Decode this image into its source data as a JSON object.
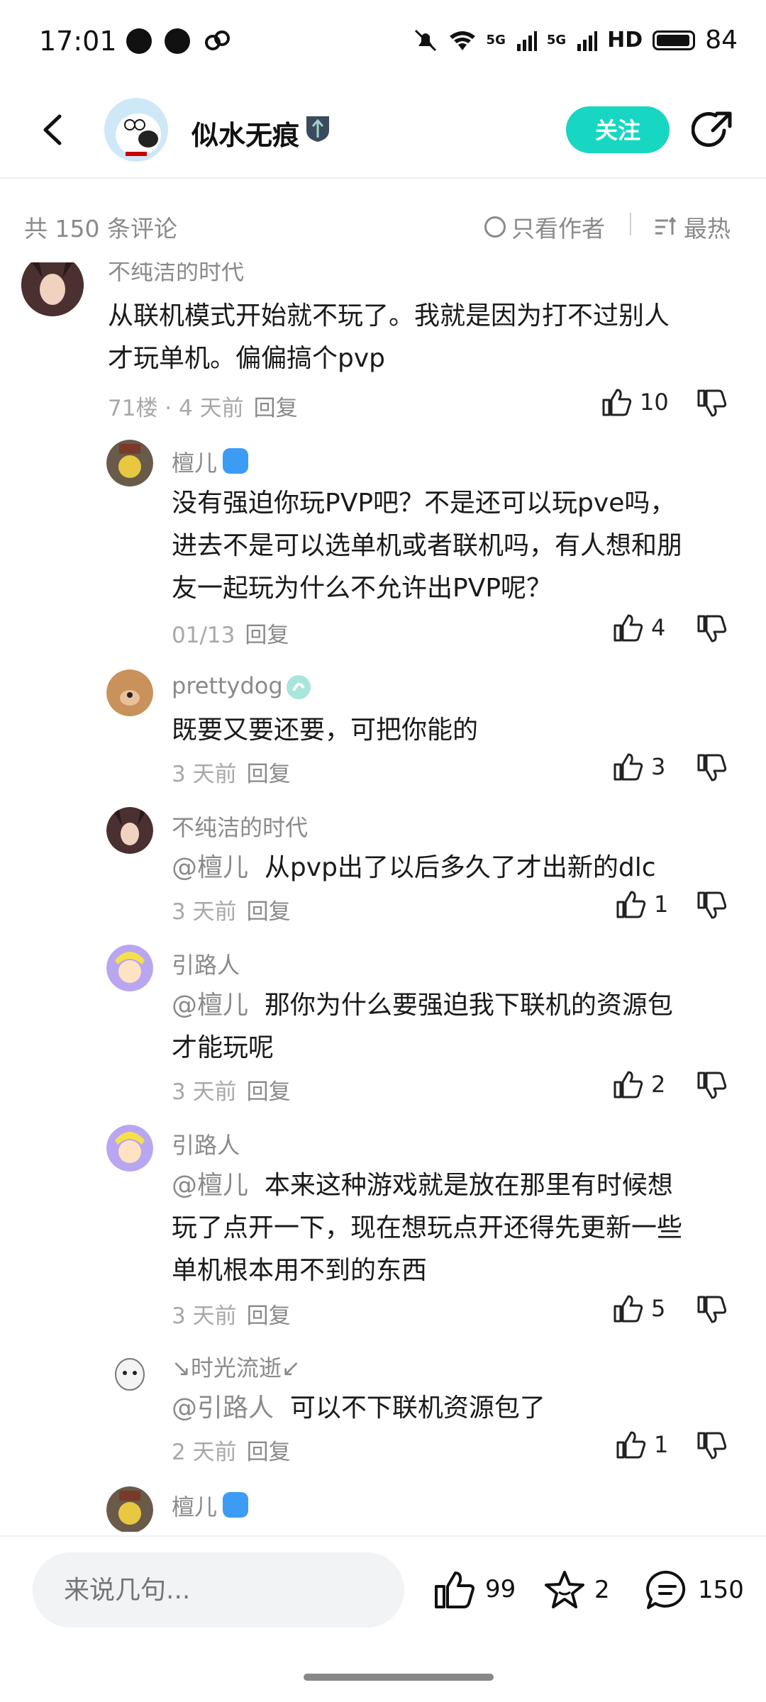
{
  "status_bar": {
    "time": "17:01",
    "network": "5G",
    "network2": "5G",
    "hd": "HD",
    "battery": "84"
  },
  "header": {
    "author_name": "似水无痕",
    "follow_label": "关注"
  },
  "filter": {
    "count_label": "共 150 条评论",
    "only_author_label": "只看作者",
    "sort_label": "最热"
  },
  "comments": [
    {
      "name": "不纯洁的时代",
      "text_lines": [
        "从联机模式开始就不玩了。我就是因为打不过别人",
        "才玩单机。偏偏搞个pvp"
      ],
      "floor": "71楼 · 4 天前",
      "reply": "回复",
      "likes": "10"
    },
    {
      "name": "檀儿",
      "text_lines": [
        "没有强迫你玩PVP吧？不是还可以玩pve吗，",
        "进去不是可以选单机或者联机吗，有人想和朋",
        "友一起玩为什么不允许出PVP呢？"
      ],
      "time": "01/13",
      "reply": "回复",
      "likes": "4"
    },
    {
      "name": "prettydog",
      "text_lines": [
        "既要又要还要，可把你能的"
      ],
      "time": "3 天前",
      "reply": "回复",
      "likes": "3"
    },
    {
      "name": "不纯洁的时代",
      "mention": "@檀儿",
      "text_lines": [
        "从pvp出了以后多久了才出新的dlc"
      ],
      "time": "3 天前",
      "reply": "回复",
      "likes": "1"
    },
    {
      "name": "引路人",
      "mention": "@檀儿",
      "text_lines": [
        "那你为什么要强迫我下联机的资源包",
        "才能玩呢"
      ],
      "time": "3 天前",
      "reply": "回复",
      "likes": "2"
    },
    {
      "name": "引路人",
      "mention": "@檀儿",
      "text_lines": [
        "本来这种游戏就是放在那里有时候想",
        "玩了点开一下，现在想玩点开还得先更新一些",
        "单机根本用不到的东西"
      ],
      "time": "3 天前",
      "reply": "回复",
      "likes": "5"
    },
    {
      "name": "↘时光流逝↙",
      "mention": "@引路人",
      "text_lines": [
        "可以不下联机资源包了"
      ],
      "time": "2 天前",
      "reply": "回复",
      "likes": "1"
    },
    {
      "name": "檀儿"
    }
  ],
  "bottom_bar": {
    "input_placeholder": "来说几句...",
    "likes": "99",
    "stars": "2",
    "comments": "150"
  }
}
